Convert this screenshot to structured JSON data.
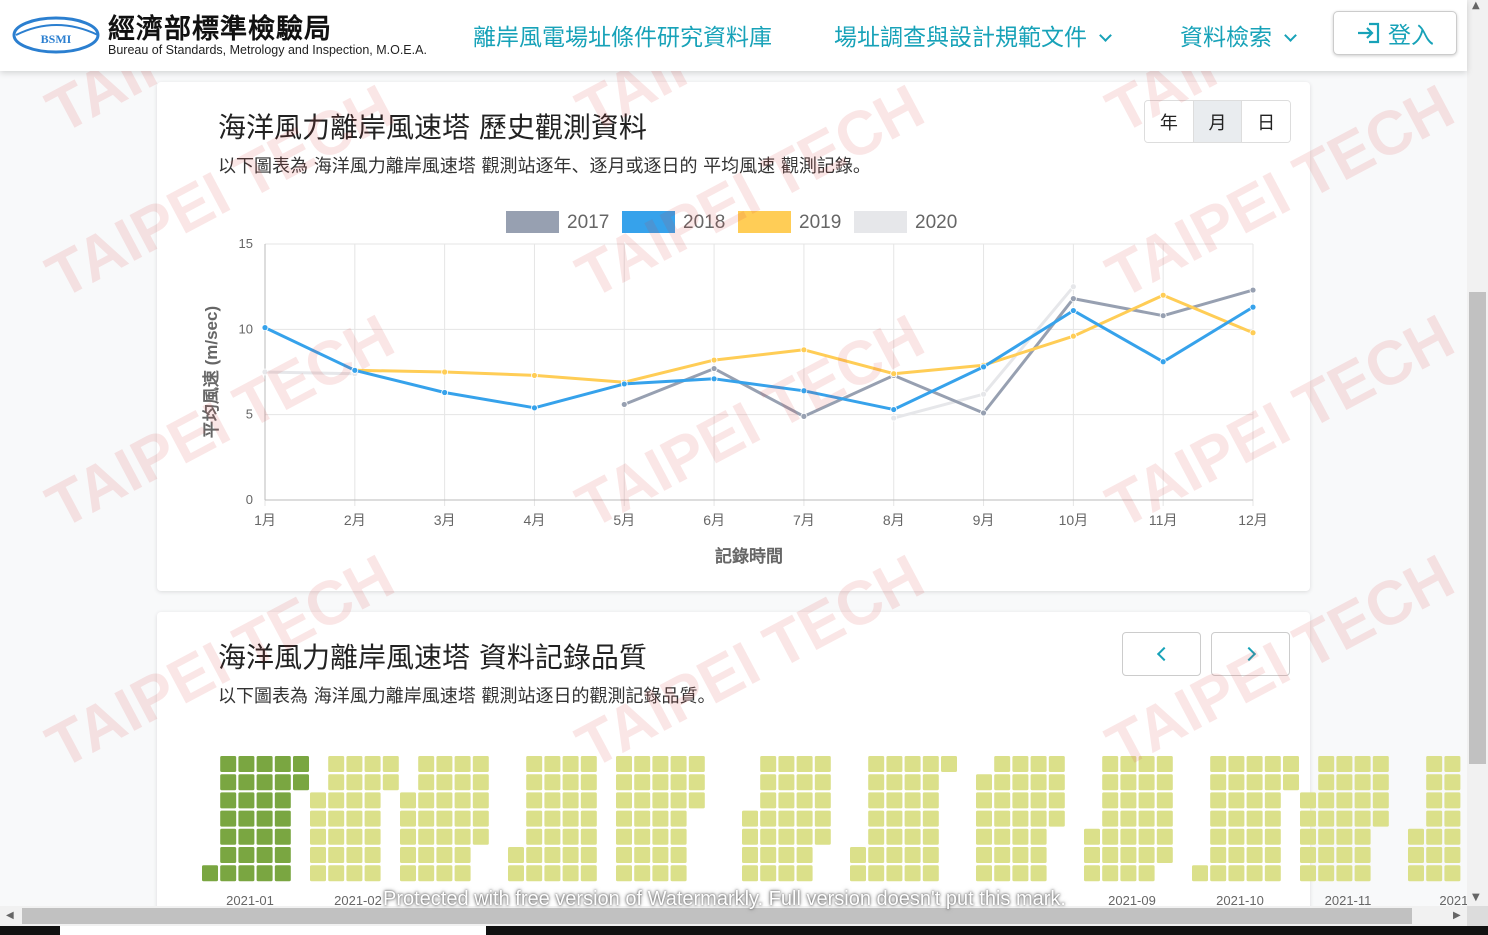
{
  "header": {
    "logo_badge": "BSMI",
    "org_name": "經濟部標準檢驗局",
    "org_name_en": "Bureau of Standards, Metrology and Inspection, M.O.E.A.",
    "nav": [
      "離岸風電場址條件研究資料庫",
      "場址調查與設計規範文件",
      "資料檢索"
    ],
    "login_label": "登入"
  },
  "history_card": {
    "title": "海洋風力離岸風速塔 歷史觀測資料",
    "description": "以下圖表為 海洋風力離岸風速塔 觀測站逐年、逐月或逐日的 平均風速 觀測記錄。",
    "period_buttons": [
      "年",
      "月",
      "日"
    ],
    "active_period": "月"
  },
  "chart_data": {
    "type": "line",
    "categories": [
      "1月",
      "2月",
      "3月",
      "4月",
      "5月",
      "6月",
      "7月",
      "8月",
      "9月",
      "10月",
      "11月",
      "12月"
    ],
    "series": [
      {
        "name": "2017",
        "color": "#97a0b1",
        "values": [
          null,
          null,
          null,
          null,
          5.6,
          7.7,
          4.9,
          7.3,
          5.1,
          11.8,
          10.8,
          12.3
        ]
      },
      {
        "name": "2018",
        "color": "#36a2eb",
        "values": [
          10.1,
          7.6,
          6.3,
          5.4,
          6.8,
          7.1,
          6.4,
          5.3,
          7.8,
          11.1,
          8.1,
          11.3
        ]
      },
      {
        "name": "2019",
        "color": "#ffcd56",
        "values": [
          null,
          7.6,
          7.5,
          7.3,
          6.9,
          8.2,
          8.8,
          7.4,
          7.9,
          9.6,
          12.0,
          9.8
        ]
      },
      {
        "name": "2020",
        "color": "#e6e7ea",
        "values": [
          7.5,
          7.4,
          null,
          null,
          null,
          null,
          null,
          4.8,
          6.2,
          12.5,
          null,
          null
        ]
      }
    ],
    "xlabel": "記錄時間",
    "ylabel": "平均風速 (m/sec)",
    "ylim": [
      0,
      15
    ],
    "yticks": [
      0,
      5,
      10,
      15
    ],
    "legend": "top-center",
    "grid": true
  },
  "quality_card": {
    "title": "海洋風力離岸風速塔 資料記錄品質",
    "description": "以下圖表為 海洋風力離岸風速塔 觀測站逐日的觀測記錄品質。",
    "colors": {
      "good": "#7aa641",
      "fair": "#dbe08a"
    },
    "months": [
      {
        "label": "2021-01",
        "start_weekday": 6,
        "days": 31,
        "good_days": 31
      },
      {
        "label": "2021-02",
        "start_weekday": 2,
        "days": 28,
        "good_days": 0
      },
      {
        "label": "",
        "start_weekday": 2,
        "days": 31,
        "good_days": 0
      },
      {
        "label": "",
        "start_weekday": 5,
        "days": 30,
        "good_days": 0
      },
      {
        "label": "",
        "start_weekday": 0,
        "days": 31,
        "good_days": 0
      },
      {
        "label": "",
        "start_weekday": 3,
        "days": 30,
        "good_days": 0
      },
      {
        "label": "",
        "start_weekday": 5,
        "days": 31,
        "good_days": 0
      },
      {
        "label": "",
        "start_weekday": 1,
        "days": 31,
        "good_days": 0
      },
      {
        "label": "2021-09",
        "start_weekday": 4,
        "days": 30,
        "good_days": 0
      },
      {
        "label": "2021-10",
        "start_weekday": 6,
        "days": 31,
        "good_days": 0
      },
      {
        "label": "2021-11",
        "start_weekday": 2,
        "days": 30,
        "good_days": 0
      },
      {
        "label": "2021-",
        "start_weekday": 4,
        "days": 31,
        "good_days": 0
      }
    ]
  },
  "watermark": {
    "brand": "TAIPEI TECH",
    "notice": "Protected with free version of Watermarkly. Full version doesn't put this mark."
  }
}
